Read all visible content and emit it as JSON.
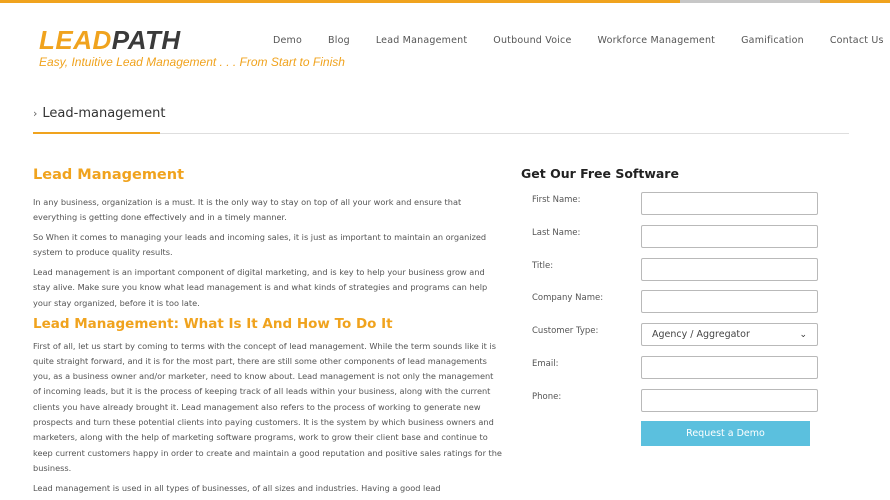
{
  "brand": {
    "logo_lead": "LEAD",
    "logo_path": "PATH",
    "tagline": "Easy, Intuitive Lead Management . . . From Start to Finish",
    "accent_color": "#f0a31e"
  },
  "nav": {
    "items": [
      "Demo",
      "Blog",
      "Lead Management",
      "Outbound Voice",
      "Workforce Management",
      "Gamification",
      "Contact Us"
    ]
  },
  "breadcrumb": {
    "label": "Lead-management",
    "icon": "chevron-right-icon"
  },
  "article": {
    "heading1": "Lead Management",
    "p1": "In any business, organization is a must. It is the only way to stay on top of all your work and ensure that everything is getting done effectively and in a timely manner.",
    "p2": "So When it comes to managing your leads and incoming sales, it is just as important to maintain an organized system to produce quality results.",
    "p3": "Lead management is an important component of digital marketing, and is key to help your business grow and stay alive. Make sure you know what lead management is and what kinds of strategies and programs can help your stay organized, before it is too late.",
    "heading2": "Lead Management: What Is It And How To Do It",
    "p4": "First of all, let us start by coming to terms with the concept of lead management. While the term sounds like it is quite straight forward, and it is for the most part, there are still some other components of lead managements you, as a business owner and/or marketer, need to know about. Lead management is not only the management of incoming leads, but it is the process of keeping track of all leads within your business, along with the current clients you have already brought it. Lead management also refers to the process of working to generate new prospects and turn these potential clients into paying customers. It is the system by which business owners and marketers, along with the help of marketing software programs, work to grow their client base and continue to keep current customers happy in order to create and maintain a good reputation and positive sales ratings for the business.",
    "p5": "Lead management is used in all types of businesses, of all sizes and industries. Having a good lead"
  },
  "form": {
    "title": "Get Our Free Software",
    "fields": [
      {
        "label": "First Name:",
        "value": ""
      },
      {
        "label": "Last Name:",
        "value": ""
      },
      {
        "label": "Title:",
        "value": ""
      },
      {
        "label": "Company Name:",
        "value": ""
      },
      {
        "label": "Customer Type:",
        "value": "Agency / Aggregator"
      },
      {
        "label": "Email:",
        "value": ""
      },
      {
        "label": "Phone:",
        "value": ""
      }
    ],
    "button_label": "Request a Demo",
    "button_color": "#5bc0de"
  }
}
